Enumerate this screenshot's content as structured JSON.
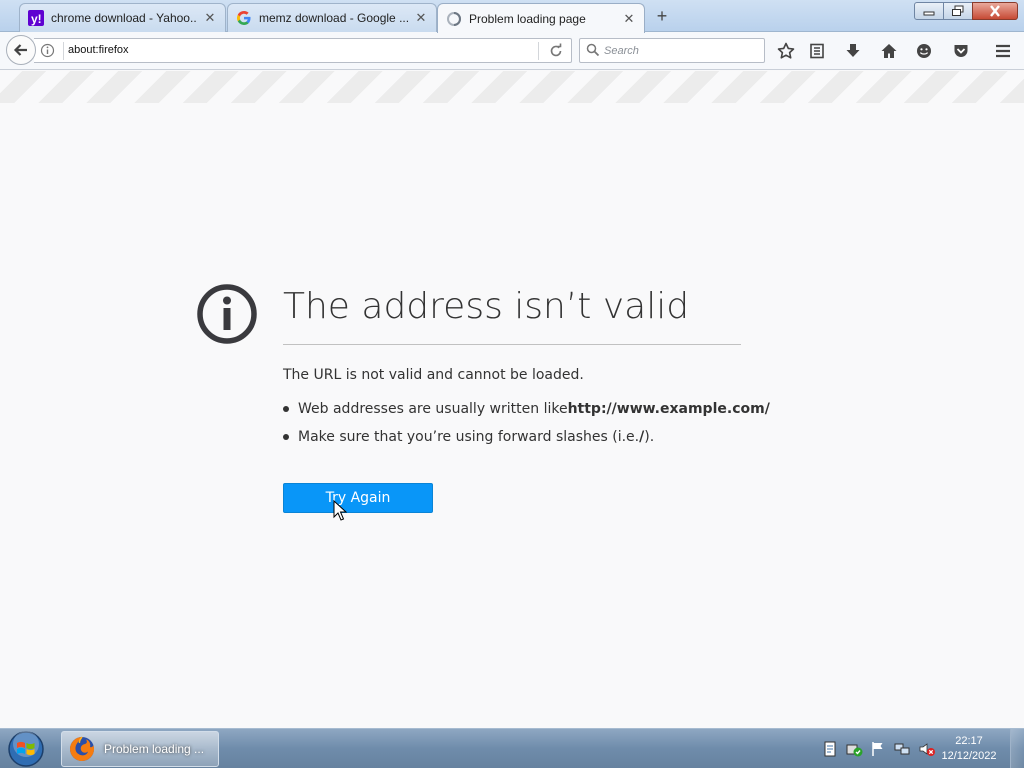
{
  "tabs": [
    {
      "label": "chrome download - Yahoo...",
      "favicon": "yahoo-icon",
      "active": false
    },
    {
      "label": "memz download - Google ...",
      "favicon": "google-icon",
      "active": false
    },
    {
      "label": "Problem loading page",
      "favicon": "page-loading-icon",
      "active": true
    }
  ],
  "address_bar": {
    "url": "about:firefox"
  },
  "search_bar": {
    "placeholder": "Search"
  },
  "toolbar_icons": [
    "bookmark-star-icon",
    "reading-list-icon",
    "downloads-icon",
    "home-icon",
    "hello-icon",
    "pocket-icon",
    "menu-icon"
  ],
  "error_page": {
    "title": "The address isn’t valid",
    "description": "The URL is not valid and cannot be loaded.",
    "bullet1_prefix": "Web addresses are usually written like ",
    "bullet1_bold": "http://www.example.com/",
    "bullet2_prefix": "Make sure that you’re using forward slashes (i.e. ",
    "bullet2_bold": "/",
    "bullet2_suffix": ").",
    "button_label": "Try Again"
  },
  "taskbar": {
    "window_label": "Problem loading ...",
    "time": "22:17",
    "date": "12/12/2022"
  },
  "colors": {
    "accent": "#0996f8",
    "page_background": "#f9f9fa",
    "title_text": "#333333"
  }
}
